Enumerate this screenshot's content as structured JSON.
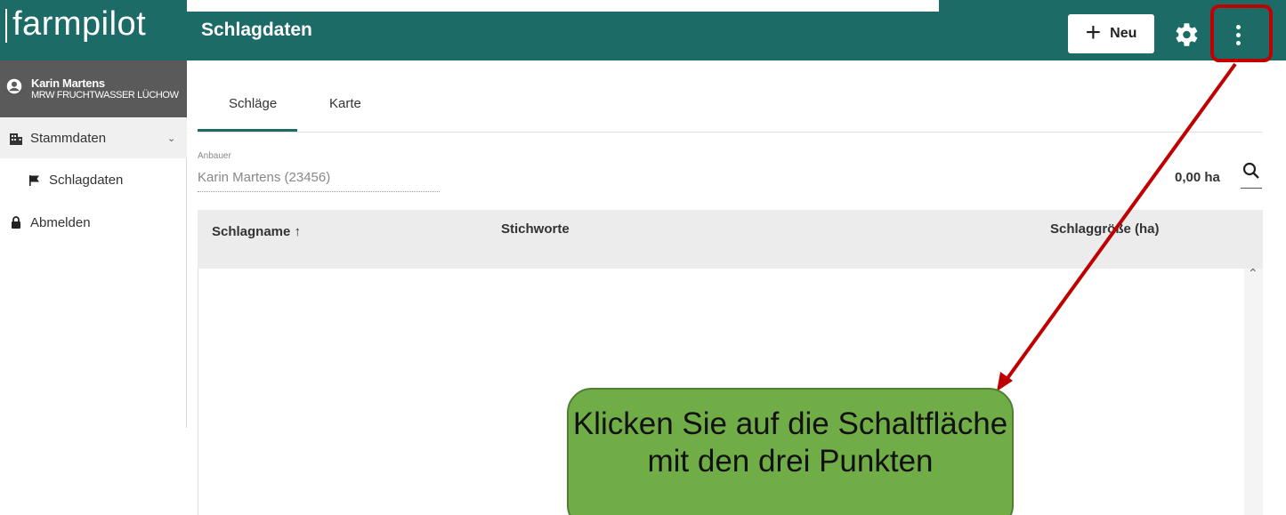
{
  "app": {
    "logo": "farmpilot",
    "title": "Schlagdaten"
  },
  "toolbar": {
    "new_label": "Neu",
    "new_icon": "plus-icon",
    "settings_icon": "gear-icon",
    "menu_icon": "more-vertical-icon"
  },
  "user": {
    "name": "Karin Martens",
    "organization": "MRW FRUCHTWASSER LÜCHOW"
  },
  "sidebar": {
    "items": [
      {
        "label": "Stammdaten",
        "icon": "building-icon",
        "expandable": true
      },
      {
        "label": "Schlagdaten",
        "icon": "flag-icon"
      },
      {
        "label": "Abmelden",
        "icon": "lock-icon"
      }
    ]
  },
  "tabs": [
    {
      "label": "Schläge",
      "active": true
    },
    {
      "label": "Karte",
      "active": false
    }
  ],
  "filter": {
    "label": "Anbauer",
    "value": "Karin Martens (23456)"
  },
  "summary": {
    "total_area": "0,00 ha"
  },
  "table": {
    "columns": [
      "Schlagname ↑",
      "Stichworte",
      "Schlaggröße (ha)"
    ],
    "rows": []
  },
  "callout": {
    "text": "Klicken Sie auf die Schaltfläche mit den drei Punkten"
  },
  "colors": {
    "primary": "#1d6b66",
    "annotation": "#c00000",
    "callout": "#70ad47"
  }
}
